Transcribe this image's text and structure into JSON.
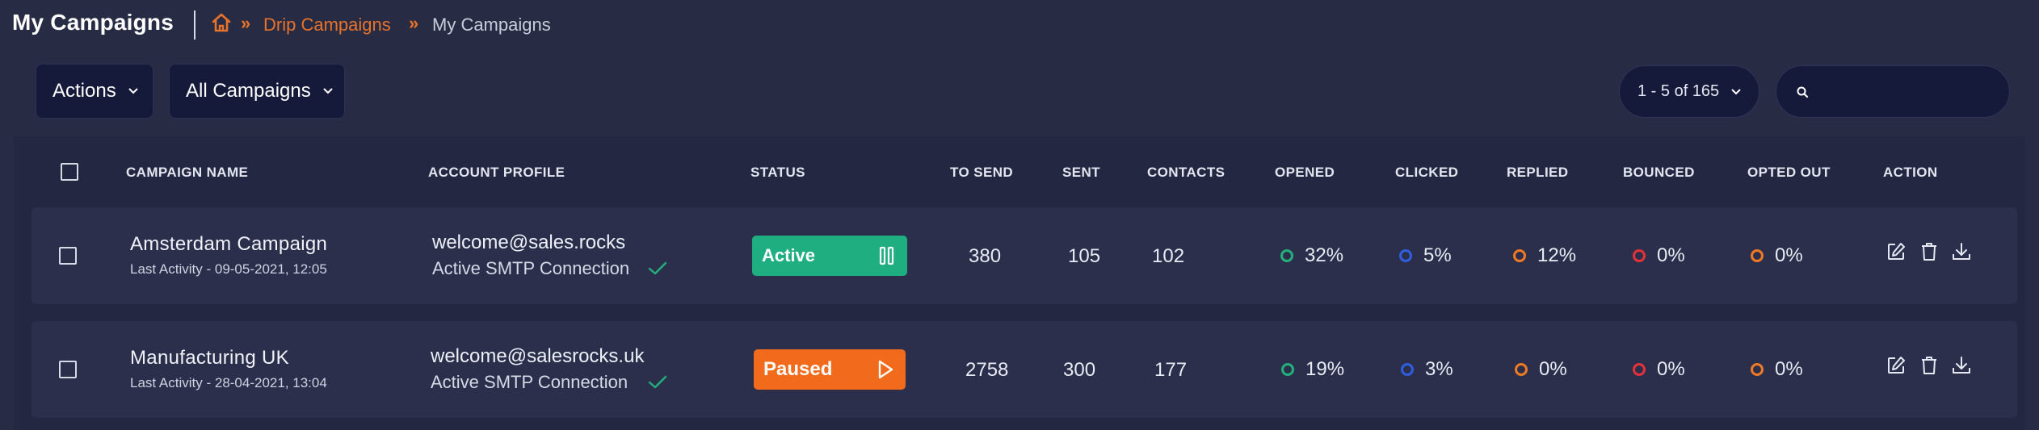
{
  "header": {
    "title": "My Campaigns",
    "breadcrumb": {
      "home_icon": "home-icon",
      "separator": "»",
      "link": "Drip Campaigns",
      "current": "My Campaigns"
    }
  },
  "toolbar": {
    "actions_label": "Actions",
    "filter_label": "All Campaigns",
    "pagination": "1 - 5 of 165",
    "search_placeholder": "",
    "search_value": ""
  },
  "table": {
    "columns": {
      "name": "CAMPAIGN NAME",
      "account": "ACCOUNT PROFILE",
      "status": "STATUS",
      "to_send": "TO SEND",
      "sent": "SENT",
      "contacts": "CONTACTS",
      "opened": "OPENED",
      "clicked": "CLICKED",
      "replied": "REPLIED",
      "bounced": "BOUNCED",
      "opted_out": "OPTED OUT",
      "action": "ACTION"
    },
    "rows": [
      {
        "name": "Amsterdam Campaign",
        "activity": "Last Activity - 09-05-2021, 12:05",
        "email": "welcome@sales.rocks",
        "connection": "Active SMTP Connection",
        "status": "Active",
        "status_icon": "pause-icon",
        "to_send": "380",
        "sent": "105",
        "contacts": "102",
        "opened": "32%",
        "clicked": "5%",
        "replied": "12%",
        "bounced": "0%",
        "opted_out": "0%"
      },
      {
        "name": "Manufacturing UK",
        "activity": "Last Activity - 28-04-2021, 13:04",
        "email": "welcome@salesrocks.uk",
        "connection": "Active SMTP Connection",
        "status": "Paused",
        "status_icon": "play-icon",
        "to_send": "2758",
        "sent": "300",
        "contacts": "177",
        "opened": "19%",
        "clicked": "3%",
        "replied": "0%",
        "bounced": "0%",
        "opted_out": "0%"
      }
    ]
  },
  "colors": {
    "accent": "#e8732a",
    "active_green": "#1fae7f",
    "paused_orange": "#f26a1b",
    "opened_ring": "#22b07d",
    "clicked_ring": "#2f5fe0",
    "replied_ring": "#f07a24",
    "bounced_ring": "#e5323a",
    "opted_out_ring": "#f07a24"
  },
  "icons": {
    "edit": "edit-icon",
    "delete": "trash-icon",
    "download": "download-icon",
    "connection_ok": "checkmark-icon"
  }
}
